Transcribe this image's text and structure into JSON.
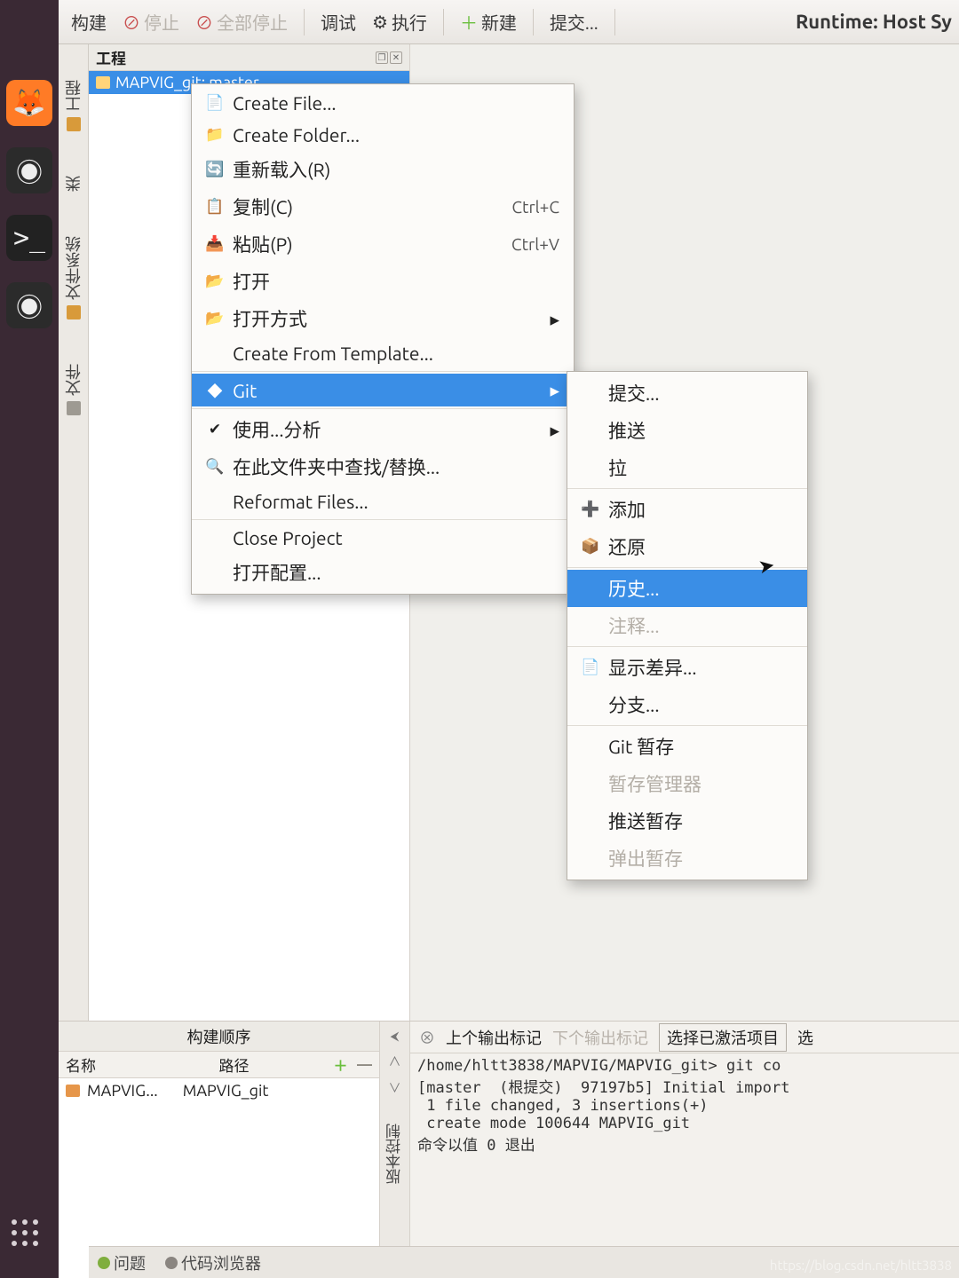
{
  "toolbar": {
    "build": "构建",
    "stop": "停止",
    "stop_all": "全部停止",
    "debug": "调试",
    "run": "执行",
    "new": "新建",
    "commit": "提交...",
    "runtime": "Runtime: Host Sy"
  },
  "sidebar_tabs": {
    "project": "工程",
    "class": "类",
    "filesystem": "文件系统",
    "files": "文件"
  },
  "project_panel": {
    "title": "工程",
    "root": "MAPVIG_git: master"
  },
  "context_menu": {
    "items": [
      {
        "icon": "new-file-icon",
        "label": "Create File...",
        "shortcut": "",
        "submenu": false
      },
      {
        "icon": "new-folder-icon",
        "label": "Create Folder...",
        "shortcut": "",
        "submenu": false
      },
      {
        "icon": "reload-icon",
        "label": "重新载入(R)",
        "shortcut": "",
        "submenu": false
      },
      {
        "icon": "copy-icon",
        "label": "复制(C)",
        "shortcut": "Ctrl+C",
        "submenu": false
      },
      {
        "icon": "paste-icon",
        "label": "粘贴(P)",
        "shortcut": "Ctrl+V",
        "submenu": false
      },
      {
        "icon": "open-icon",
        "label": "打开",
        "shortcut": "",
        "submenu": false
      },
      {
        "icon": "open-with-icon",
        "label": "打开方式",
        "shortcut": "",
        "submenu": true
      },
      {
        "icon": "",
        "label": "Create From Template...",
        "shortcut": "",
        "submenu": false
      },
      {
        "icon": "git-icon",
        "label": "Git",
        "shortcut": "",
        "submenu": true,
        "selected": true
      },
      {
        "icon": "check-icon",
        "label": "使用...分析",
        "shortcut": "",
        "submenu": true
      },
      {
        "icon": "search-icon",
        "label": "在此文件夹中查找/替换...",
        "shortcut": "",
        "submenu": false
      },
      {
        "icon": "",
        "label": "Reformat Files...",
        "shortcut": "",
        "submenu": false
      },
      {
        "icon": "",
        "label": "Close Project",
        "shortcut": "",
        "submenu": false
      },
      {
        "icon": "",
        "label": "打开配置...",
        "shortcut": "",
        "submenu": false
      }
    ]
  },
  "git_submenu": {
    "items": [
      {
        "icon": "",
        "label": "提交...",
        "disabled": false
      },
      {
        "icon": "",
        "label": "推送",
        "disabled": false
      },
      {
        "icon": "",
        "label": "拉",
        "disabled": false
      },
      {
        "icon": "plus-icon",
        "label": "添加",
        "disabled": false
      },
      {
        "icon": "revert-icon",
        "label": "还原",
        "disabled": false
      },
      {
        "icon": "",
        "label": "历史...",
        "disabled": false,
        "selected": true
      },
      {
        "icon": "",
        "label": "注释...",
        "disabled": true
      },
      {
        "icon": "diff-icon",
        "label": "显示差异...",
        "disabled": false
      },
      {
        "icon": "",
        "label": "分支...",
        "disabled": false
      },
      {
        "icon": "",
        "label": "Git 暂存",
        "disabled": false
      },
      {
        "icon": "",
        "label": "暂存管理器",
        "disabled": true
      },
      {
        "icon": "",
        "label": "推送暂存",
        "disabled": false
      },
      {
        "icon": "",
        "label": "弹出暂存",
        "disabled": true
      }
    ]
  },
  "build_order": {
    "title": "构建顺序",
    "col_name": "名称",
    "col_path": "路径",
    "row_name": "MAPVIG...",
    "row_path": "MAPVIG_git"
  },
  "console": {
    "tabs": {
      "prev": "上个输出标记",
      "next": "下个输出标记",
      "select": "选择已激活项目",
      "more": "选"
    },
    "side_label": "版本控制",
    "lines": [
      "/home/hltt3838/MAPVIG/MAPVIG_git> git co",
      "[master  (根提交)  97197b5] Initial import",
      " 1 file changed, 3 insertions(+)",
      " create mode 100644 MAPVIG_git",
      "命令以值 0 退出"
    ]
  },
  "statusbar": {
    "issues": "问题",
    "browser": "代码浏览器"
  },
  "watermark": "https://blog.csdn.net/hltt3838"
}
